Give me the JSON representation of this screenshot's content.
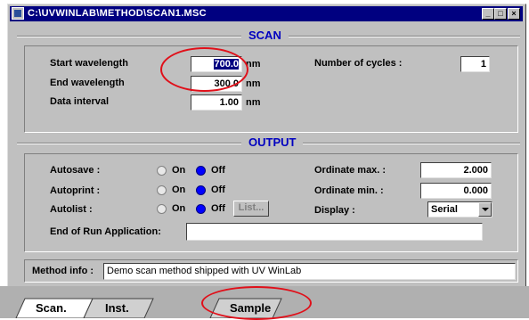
{
  "window": {
    "title": "C:\\UVWINLAB\\METHOD\\SCAN1.MSC",
    "controls": {
      "minimize": "_",
      "maximize": "□",
      "close": "×"
    }
  },
  "scan": {
    "heading": "SCAN",
    "start_wavelength": {
      "label": "Start wavelength",
      "value": "700.0",
      "unit": "nm"
    },
    "end_wavelength": {
      "label": "End wavelength",
      "value": "300.0",
      "unit": "nm"
    },
    "data_interval": {
      "label": "Data interval",
      "value": "1.00",
      "unit": "nm"
    },
    "cycles": {
      "label": "Number of cycles :",
      "value": "1"
    }
  },
  "output": {
    "heading": "OUTPUT",
    "on_label": "On",
    "off_label": "Off",
    "autosave": {
      "label": "Autosave :",
      "state": "Off"
    },
    "autoprint": {
      "label": "Autoprint :",
      "state": "Off"
    },
    "autolist": {
      "label": "Autolist :",
      "state": "Off",
      "list_button": "List..."
    },
    "ordinate_max": {
      "label": "Ordinate max. :",
      "value": "2.000"
    },
    "ordinate_min": {
      "label": "Ordinate min. :",
      "value": "0.000"
    },
    "display": {
      "label": "Display :",
      "value": "Serial"
    },
    "end_of_run": {
      "label": "End of Run Application:",
      "value": ""
    },
    "method_info": {
      "label": "Method info :",
      "value": "Demo scan method shipped with UV WinLab"
    }
  },
  "tabs": [
    "Scan.",
    "Inst.",
    "Sample"
  ],
  "colors": {
    "titlebar": "#000080",
    "section_heading": "#0000c0",
    "annotation_circle": "#e0101a"
  }
}
